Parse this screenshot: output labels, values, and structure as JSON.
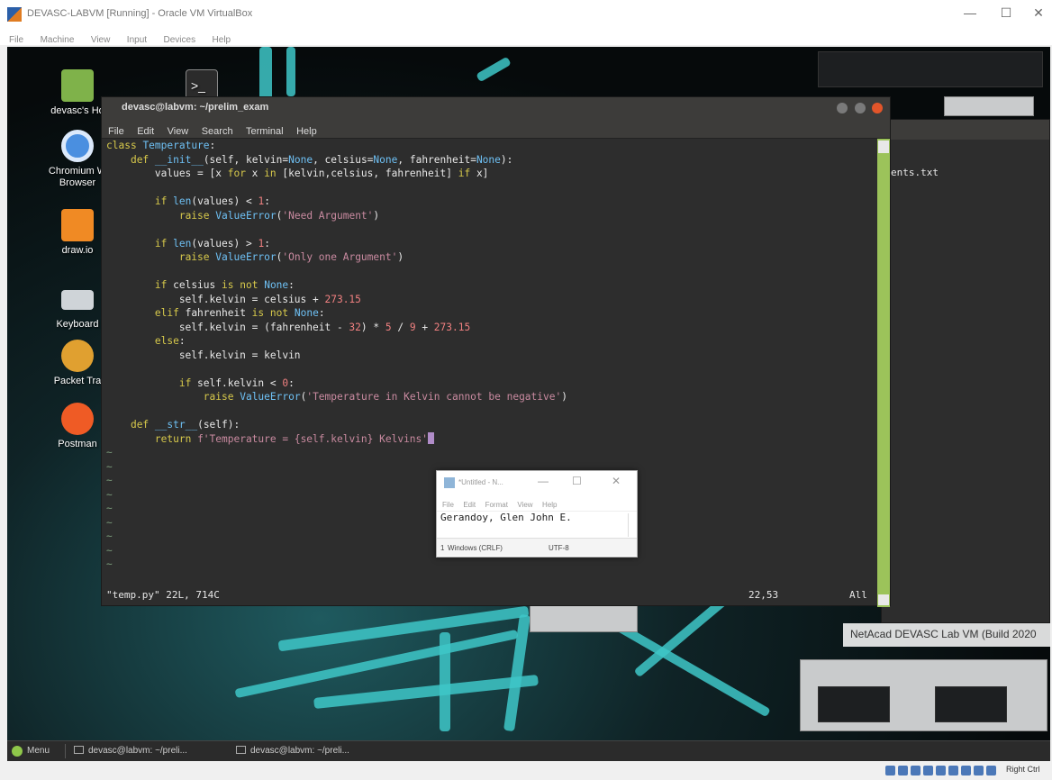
{
  "host_window": {
    "title": "DEVASC-LABVM [Running] - Oracle VM VirtualBox",
    "menu": [
      "File",
      "Machine",
      "View",
      "Input",
      "Devices",
      "Help"
    ],
    "controls": {
      "minimize": "—",
      "maximize": "☐",
      "close": "✕"
    },
    "status_right": "Right Ctrl"
  },
  "desktop_icons": [
    {
      "label": "devasc's Ho",
      "icon": "folder-icon",
      "color": "#7fb24a"
    },
    {
      "label": "",
      "icon": "terminal-icon",
      "color": "#2b2b2b"
    },
    {
      "label": "Chromium W\nBrowser",
      "icon": "chromium-icon",
      "color": "#4a8fe0"
    },
    {
      "label": "draw.io",
      "icon": "drawio-icon",
      "color": "#f08a24"
    },
    {
      "label": "Keyboard",
      "icon": "keyboard-icon",
      "color": "#cfd4d8"
    },
    {
      "label": "Packet Tra",
      "icon": "packet-tracer-icon",
      "color": "#e0a030"
    },
    {
      "label": "Postman",
      "icon": "postman-icon",
      "color": "#ef5b25"
    }
  ],
  "terminal": {
    "title": "devasc@labvm: ~/prelim_exam",
    "menu": [
      "File",
      "Edit",
      "View",
      "Search",
      "Terminal",
      "Help"
    ],
    "status_file": "\"temp.py\" 22L, 714C",
    "status_pos": "22,53",
    "status_all": "All",
    "code_lines": [
      "class Temperature:",
      "    def __init__(self, kelvin=None, celsius=None, fahrenheit=None):",
      "        values = [x for x in [kelvin,celsius, fahrenheit] if x]",
      "",
      "        if len(values) < 1:",
      "            raise ValueError('Need Argument')",
      "",
      "        if len(values) > 1:",
      "            raise ValueError('Only one Argument')",
      "",
      "        if celsius is not None:",
      "            self.kelvin = celsius + 273.15",
      "        elif fahrenheit is not None:",
      "            self.kelvin = (fahrenheit - 32) * 5 / 9 + 273.15",
      "        else:",
      "            self.kelvin = kelvin",
      "",
      "            if self.kelvin < 0:",
      "                raise ValueError('Temperature in Kelvin cannot be negative')",
      "",
      "    def __str__(self):",
      "        return f'Temperature = {self.kelvin} Kelvins'"
    ],
    "tilde_count": 9
  },
  "background_terminal": {
    "partial_text": "ents.txt"
  },
  "notepad": {
    "title": "*Untitled - N...",
    "menu": [
      "File",
      "Edit",
      "Format",
      "View",
      "Help"
    ],
    "text": "Gerandoy, Glen John E.",
    "line_ending": "Windows (CRLF)",
    "line_prefix": "1",
    "encoding": "UTF-8"
  },
  "taskbar": {
    "menu_label": "Menu",
    "tasks": [
      "devasc@labvm: ~/preli...",
      "devasc@labvm: ~/preli..."
    ]
  },
  "wallpaper_label": "NetAcad DEVASC Lab VM (Build 2020"
}
